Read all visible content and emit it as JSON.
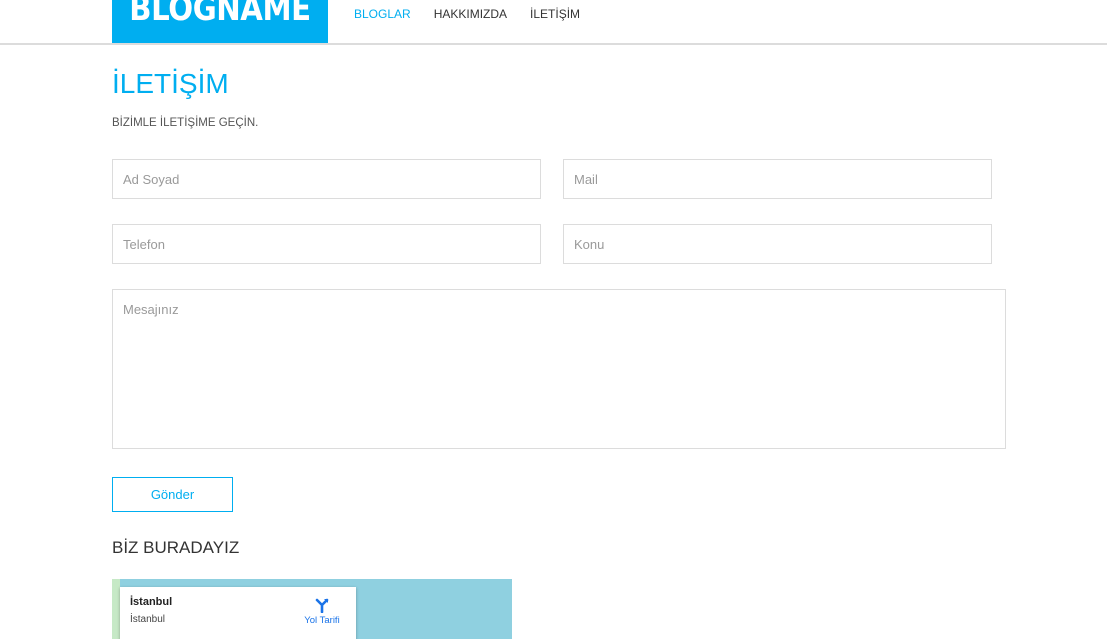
{
  "brand": {
    "logo_text": "BLOGNAME",
    "accent_color": "#00aef0"
  },
  "nav": {
    "items": [
      {
        "label": "BLOGLAR",
        "active": true
      },
      {
        "label": "HAKKIMIZDA",
        "active": false
      },
      {
        "label": "İLETİŞİM",
        "active": false
      }
    ]
  },
  "page": {
    "title": "İLETİŞİM",
    "subtitle": "BİZİMLE İLETİŞİME GEÇİN."
  },
  "form": {
    "name_placeholder": "Ad Soyad",
    "mail_placeholder": "Mail",
    "phone_placeholder": "Telefon",
    "subject_placeholder": "Konu",
    "message_placeholder": "Mesajınız",
    "submit_label": "Gönder"
  },
  "location": {
    "section_title": "BİZ BURADAYIZ",
    "map": {
      "place_title": "İstanbul",
      "place_subtitle": "İstanbul",
      "directions_label": "Yol Tarifi",
      "directions_icon": "directions-icon"
    }
  }
}
